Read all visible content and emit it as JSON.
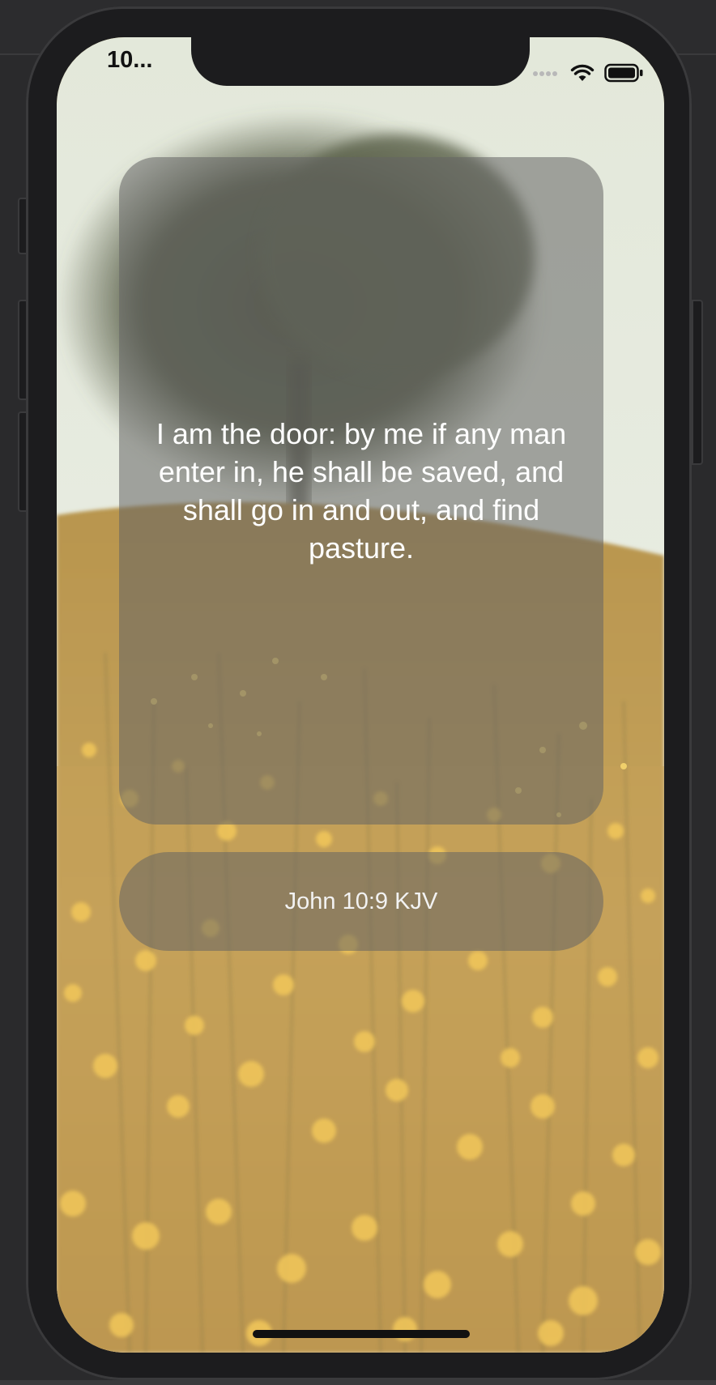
{
  "status_bar": {
    "time": "10...",
    "wifi_icon": "wifi-icon",
    "battery_icon": "battery-icon"
  },
  "verse": {
    "text": "I am the door: by me if any man enter in, he shall be saved, and shall go in and out, and find pasture.",
    "reference": "John 10:9 KJV"
  },
  "colors": {
    "card_overlay": "#646464",
    "text": "#ffffff",
    "sky": "#e9ecde",
    "field": "#c9a85a",
    "flowers": "#f0c050"
  }
}
